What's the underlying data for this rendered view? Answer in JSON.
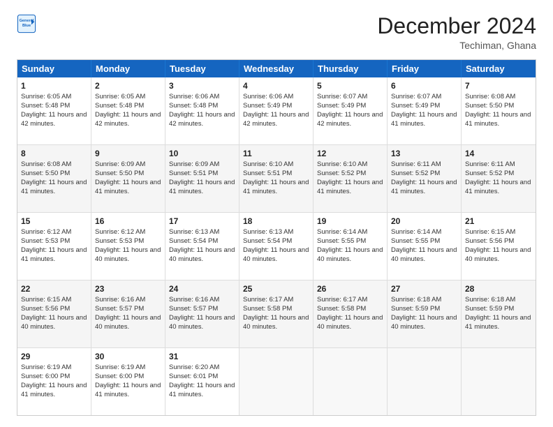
{
  "logo": {
    "line1": "General",
    "line2": "Blue"
  },
  "header": {
    "title": "December 2024",
    "subtitle": "Techiman, Ghana"
  },
  "weekdays": [
    "Sunday",
    "Monday",
    "Tuesday",
    "Wednesday",
    "Thursday",
    "Friday",
    "Saturday"
  ],
  "rows": [
    [
      {
        "day": "1",
        "sunrise": "6:05 AM",
        "sunset": "5:48 PM",
        "daylight": "11 hours and 42 minutes."
      },
      {
        "day": "2",
        "sunrise": "6:05 AM",
        "sunset": "5:48 PM",
        "daylight": "11 hours and 42 minutes."
      },
      {
        "day": "3",
        "sunrise": "6:06 AM",
        "sunset": "5:48 PM",
        "daylight": "11 hours and 42 minutes."
      },
      {
        "day": "4",
        "sunrise": "6:06 AM",
        "sunset": "5:49 PM",
        "daylight": "11 hours and 42 minutes."
      },
      {
        "day": "5",
        "sunrise": "6:07 AM",
        "sunset": "5:49 PM",
        "daylight": "11 hours and 42 minutes."
      },
      {
        "day": "6",
        "sunrise": "6:07 AM",
        "sunset": "5:49 PM",
        "daylight": "11 hours and 41 minutes."
      },
      {
        "day": "7",
        "sunrise": "6:08 AM",
        "sunset": "5:50 PM",
        "daylight": "11 hours and 41 minutes."
      }
    ],
    [
      {
        "day": "8",
        "sunrise": "6:08 AM",
        "sunset": "5:50 PM",
        "daylight": "11 hours and 41 minutes."
      },
      {
        "day": "9",
        "sunrise": "6:09 AM",
        "sunset": "5:50 PM",
        "daylight": "11 hours and 41 minutes."
      },
      {
        "day": "10",
        "sunrise": "6:09 AM",
        "sunset": "5:51 PM",
        "daylight": "11 hours and 41 minutes."
      },
      {
        "day": "11",
        "sunrise": "6:10 AM",
        "sunset": "5:51 PM",
        "daylight": "11 hours and 41 minutes."
      },
      {
        "day": "12",
        "sunrise": "6:10 AM",
        "sunset": "5:52 PM",
        "daylight": "11 hours and 41 minutes."
      },
      {
        "day": "13",
        "sunrise": "6:11 AM",
        "sunset": "5:52 PM",
        "daylight": "11 hours and 41 minutes."
      },
      {
        "day": "14",
        "sunrise": "6:11 AM",
        "sunset": "5:52 PM",
        "daylight": "11 hours and 41 minutes."
      }
    ],
    [
      {
        "day": "15",
        "sunrise": "6:12 AM",
        "sunset": "5:53 PM",
        "daylight": "11 hours and 41 minutes."
      },
      {
        "day": "16",
        "sunrise": "6:12 AM",
        "sunset": "5:53 PM",
        "daylight": "11 hours and 40 minutes."
      },
      {
        "day": "17",
        "sunrise": "6:13 AM",
        "sunset": "5:54 PM",
        "daylight": "11 hours and 40 minutes."
      },
      {
        "day": "18",
        "sunrise": "6:13 AM",
        "sunset": "5:54 PM",
        "daylight": "11 hours and 40 minutes."
      },
      {
        "day": "19",
        "sunrise": "6:14 AM",
        "sunset": "5:55 PM",
        "daylight": "11 hours and 40 minutes."
      },
      {
        "day": "20",
        "sunrise": "6:14 AM",
        "sunset": "5:55 PM",
        "daylight": "11 hours and 40 minutes."
      },
      {
        "day": "21",
        "sunrise": "6:15 AM",
        "sunset": "5:56 PM",
        "daylight": "11 hours and 40 minutes."
      }
    ],
    [
      {
        "day": "22",
        "sunrise": "6:15 AM",
        "sunset": "5:56 PM",
        "daylight": "11 hours and 40 minutes."
      },
      {
        "day": "23",
        "sunrise": "6:16 AM",
        "sunset": "5:57 PM",
        "daylight": "11 hours and 40 minutes."
      },
      {
        "day": "24",
        "sunrise": "6:16 AM",
        "sunset": "5:57 PM",
        "daylight": "11 hours and 40 minutes."
      },
      {
        "day": "25",
        "sunrise": "6:17 AM",
        "sunset": "5:58 PM",
        "daylight": "11 hours and 40 minutes."
      },
      {
        "day": "26",
        "sunrise": "6:17 AM",
        "sunset": "5:58 PM",
        "daylight": "11 hours and 40 minutes."
      },
      {
        "day": "27",
        "sunrise": "6:18 AM",
        "sunset": "5:59 PM",
        "daylight": "11 hours and 40 minutes."
      },
      {
        "day": "28",
        "sunrise": "6:18 AM",
        "sunset": "5:59 PM",
        "daylight": "11 hours and 41 minutes."
      }
    ],
    [
      {
        "day": "29",
        "sunrise": "6:19 AM",
        "sunset": "6:00 PM",
        "daylight": "11 hours and 41 minutes."
      },
      {
        "day": "30",
        "sunrise": "6:19 AM",
        "sunset": "6:00 PM",
        "daylight": "11 hours and 41 minutes."
      },
      {
        "day": "31",
        "sunrise": "6:20 AM",
        "sunset": "6:01 PM",
        "daylight": "11 hours and 41 minutes."
      },
      null,
      null,
      null,
      null
    ]
  ],
  "labels": {
    "sunrise_prefix": "Sunrise: ",
    "sunset_prefix": "Sunset: ",
    "daylight_prefix": "Daylight: "
  }
}
